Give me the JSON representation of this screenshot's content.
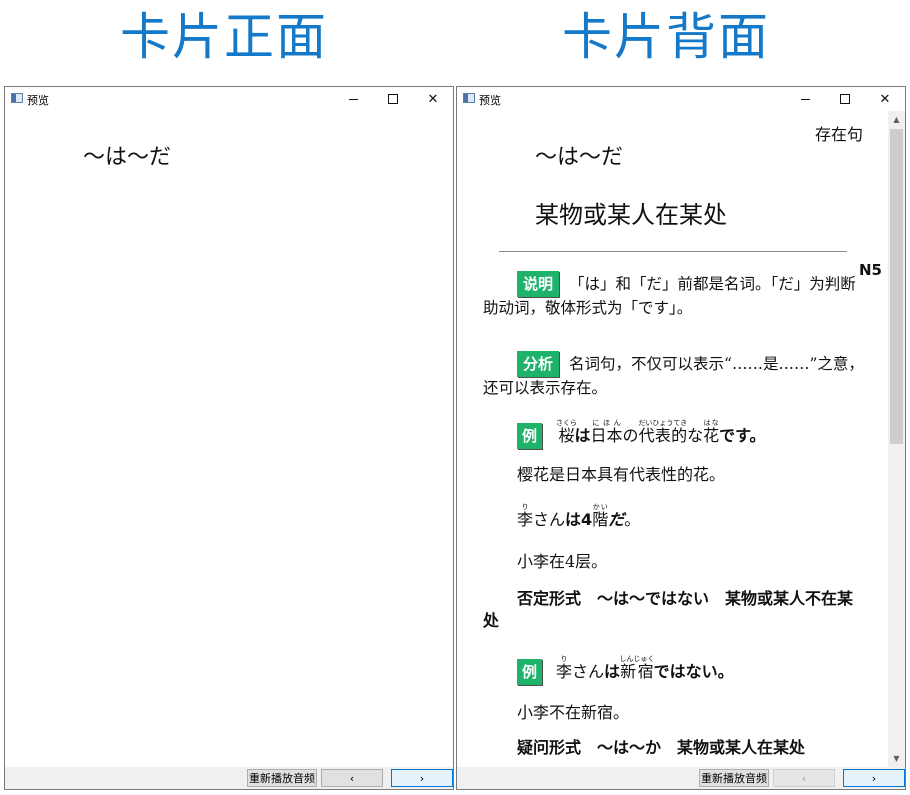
{
  "headings": {
    "front": "卡片正面",
    "back": "卡片背面"
  },
  "window": {
    "title": "预览"
  },
  "buttons": {
    "replay": "重新播放音频",
    "prev": "‹",
    "next": "›"
  },
  "front": {
    "expression": "～は～だ"
  },
  "back": {
    "category": "存在句",
    "expression": "～は～だ",
    "meaning": "某物或某人在某处",
    "level": "N5",
    "explanation_tag": "说明",
    "explanation_text": "「は」和「だ」前都是名词。「だ」为判断助动词，敬体形式为「です」。",
    "analysis_tag": "分析",
    "analysis_text": "名词句，不仅可以表示“……是……”之意，还可以表示存在。",
    "example_tag": "例",
    "ex1": {
      "w1": "桜",
      "r1": "さくら",
      "p1": "は",
      "w2": "日本",
      "r2": "にほん",
      "p2": "の",
      "w3": "代表的",
      "r3": "だいひょうてき",
      "p3": "な",
      "w4": "花",
      "r4": "はな",
      "p4": "です。"
    },
    "ex1_translation": "樱花是日本具有代表性的花。",
    "ex2": {
      "w1": "李",
      "r1": "り",
      "p1": "さん",
      "p2": "は",
      "p3": "4",
      "w2": "階",
      "r2": "かい",
      "p4": "だ",
      "p5": "。"
    },
    "ex2_translation": "小李在4层。",
    "negative_text": "否定形式　～は～ではない　某物或某人不在某处",
    "ex3": {
      "w1": "李",
      "r1": "り",
      "p1": "さん",
      "p2": "は",
      "w2": "新宿",
      "r2": "しんじゅく",
      "p3": "ではない。"
    },
    "ex3_translation": "小李不在新宿。",
    "question_text": "疑问形式　～は～か　某物或某人在某处"
  }
}
